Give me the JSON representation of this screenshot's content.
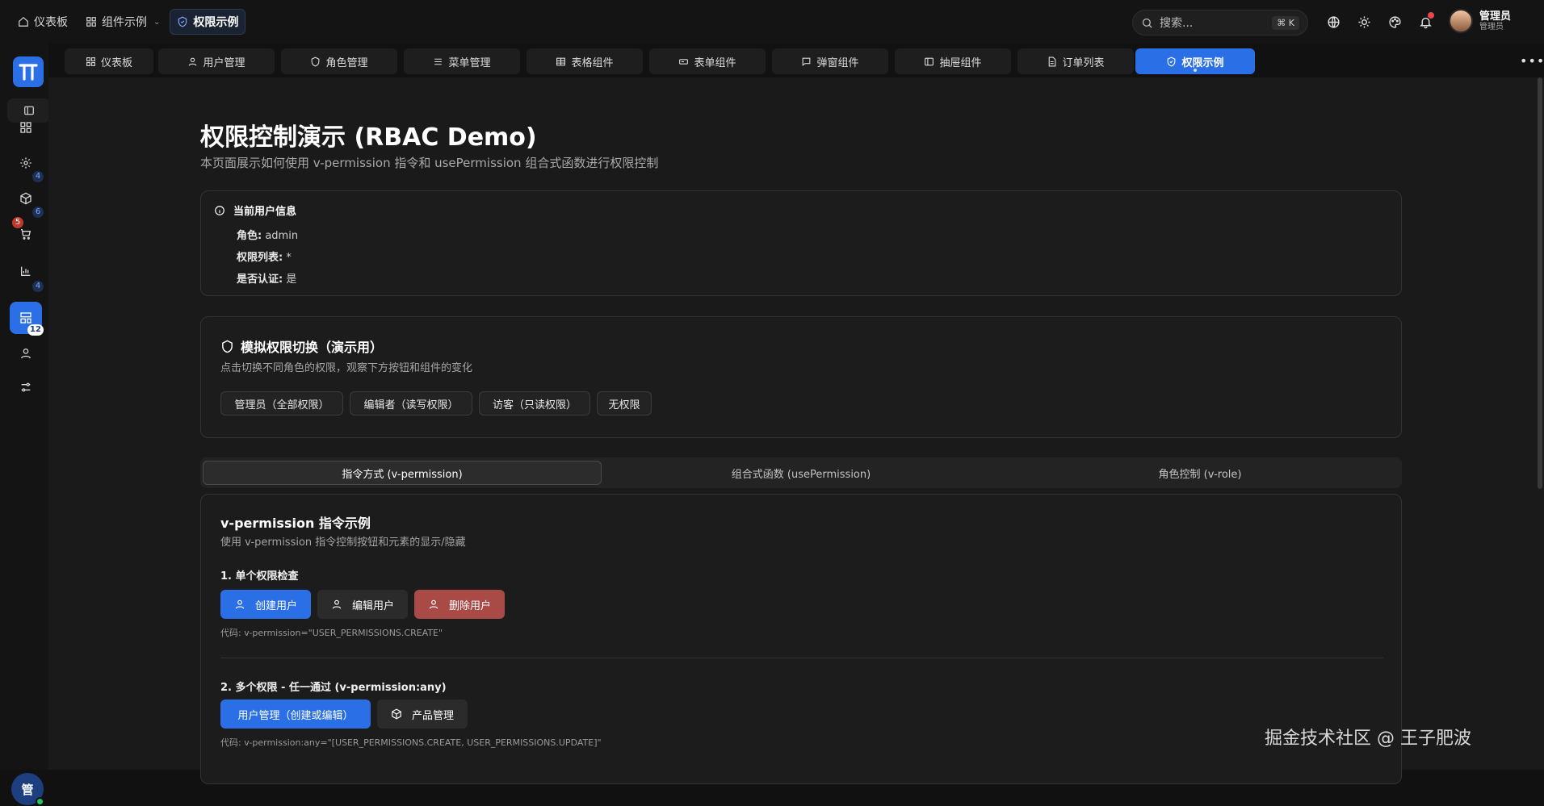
{
  "breadcrumb": {
    "home": "仪表板",
    "components": "组件示例",
    "current": "权限示例"
  },
  "search": {
    "placeholder": "搜索...",
    "shortcut": "⌘ K"
  },
  "user": {
    "name": "管理员",
    "role": "管理员",
    "avatar_initial": "管"
  },
  "sidebar": {
    "logo": "TT",
    "badges": {
      "settings": "4",
      "box": "6",
      "cart_red": "5",
      "chart": "4",
      "layout": "12"
    }
  },
  "tabs": [
    {
      "label": "仪表板",
      "icon": "dashboard-icon"
    },
    {
      "label": "用户管理",
      "icon": "user-icon"
    },
    {
      "label": "角色管理",
      "icon": "shield-icon"
    },
    {
      "label": "菜单管理",
      "icon": "menu-icon"
    },
    {
      "label": "表格组件",
      "icon": "table-icon"
    },
    {
      "label": "表单组件",
      "icon": "form-icon"
    },
    {
      "label": "弹窗组件",
      "icon": "chat-icon"
    },
    {
      "label": "抽屉组件",
      "icon": "drawer-icon"
    },
    {
      "label": "订单列表",
      "icon": "document-icon"
    },
    {
      "label": "权限示例",
      "icon": "shield-check-icon",
      "active": true
    }
  ],
  "page": {
    "title": "权限控制演示 (RBAC Demo)",
    "subtitle": "本页面展示如何使用 v-permission 指令和 usePermission 组合式函数进行权限控制"
  },
  "user_info": {
    "title": "当前用户信息",
    "role_label": "角色:",
    "role_value": "admin",
    "perms_label": "权限列表:",
    "perms_value": "*",
    "auth_label": "是否认证:",
    "auth_value": "是"
  },
  "switcher": {
    "title": "模拟权限切换（演示用）",
    "subtitle": "点击切换不同角色的权限，观察下方按钮和组件的变化",
    "buttons": [
      "管理员（全部权限）",
      "编辑者（读写权限）",
      "访客（只读权限）",
      "无权限"
    ]
  },
  "mode_tabs": [
    "指令方式 (v-permission)",
    "组合式函数 (usePermission)",
    "角色控制 (v-role)"
  ],
  "directive": {
    "title": "v-permission 指令示例",
    "subtitle": "使用 v-permission 指令控制按钮和元素的显示/隐藏",
    "s1_title": "1. 单个权限检查",
    "s1_buttons": [
      "创建用户",
      "编辑用户",
      "删除用户"
    ],
    "s1_code": "代码: v-permission=\"USER_PERMISSIONS.CREATE\"",
    "s2_title": "2. 多个权限 - 任一通过 (v-permission:any)",
    "s2_buttons": [
      "用户管理（创建或编辑）",
      "产品管理"
    ],
    "s2_code": "代码: v-permission:any=\"[USER_PERMISSIONS.CREATE, USER_PERMISSIONS.UPDATE]\""
  },
  "watermark": "掘金技术社区 @ 王子肥波"
}
